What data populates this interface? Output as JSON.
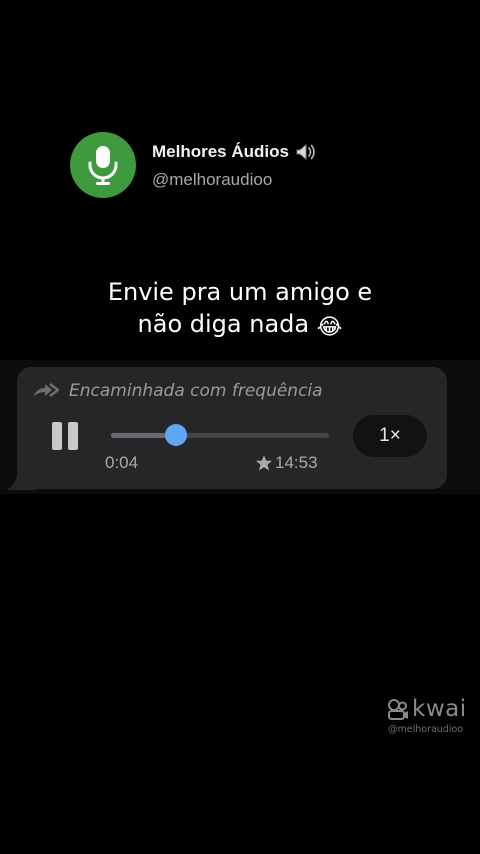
{
  "profile": {
    "avatar_icon": "microphone-icon",
    "avatar_color": "#3f9a3d",
    "name": "Melhores Áudios",
    "name_icon": "speaker-icon",
    "handle": "@melhoraudioo"
  },
  "headline": {
    "line1": "Envie pra um amigo e",
    "line2": "não diga nada",
    "emoji": "😂"
  },
  "audio_message": {
    "forward_icon": "forward-arrows-icon",
    "forwarded_label": "Encaminhada com frequência",
    "playback_state_icon": "pause-icon",
    "progress_fraction": 0.3,
    "elapsed": "0:04",
    "duration": "14:53",
    "duration_icon": "star-icon",
    "speed": "1×",
    "knob_color": "#5ea8f5",
    "bubble_color": "#262628"
  },
  "watermark": {
    "brand": "kwai",
    "handle": "@melhoraudioo",
    "logo_icon": "kwai-logo-icon"
  }
}
